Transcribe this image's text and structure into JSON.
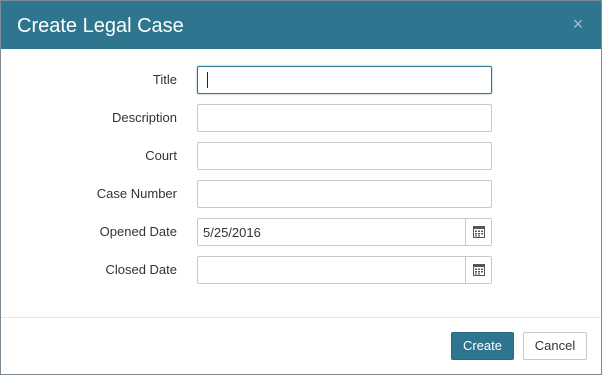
{
  "dialog": {
    "title": "Create Legal Case",
    "close_symbol": "×"
  },
  "form": {
    "fields": [
      {
        "label": "Title",
        "value": "",
        "type": "text",
        "focused": true
      },
      {
        "label": "Description",
        "value": "",
        "type": "text"
      },
      {
        "label": "Court",
        "value": "",
        "type": "text"
      },
      {
        "label": "Case Number",
        "value": "",
        "type": "text"
      },
      {
        "label": "Opened Date",
        "value": "5/25/2016",
        "type": "date",
        "icon": "calendar-icon"
      },
      {
        "label": "Closed Date",
        "value": "",
        "type": "date",
        "icon": "calendar-icon"
      }
    ]
  },
  "footer": {
    "create_label": "Create",
    "cancel_label": "Cancel"
  },
  "colors": {
    "header_bg": "#2e7590",
    "primary_button": "#2e7590"
  }
}
